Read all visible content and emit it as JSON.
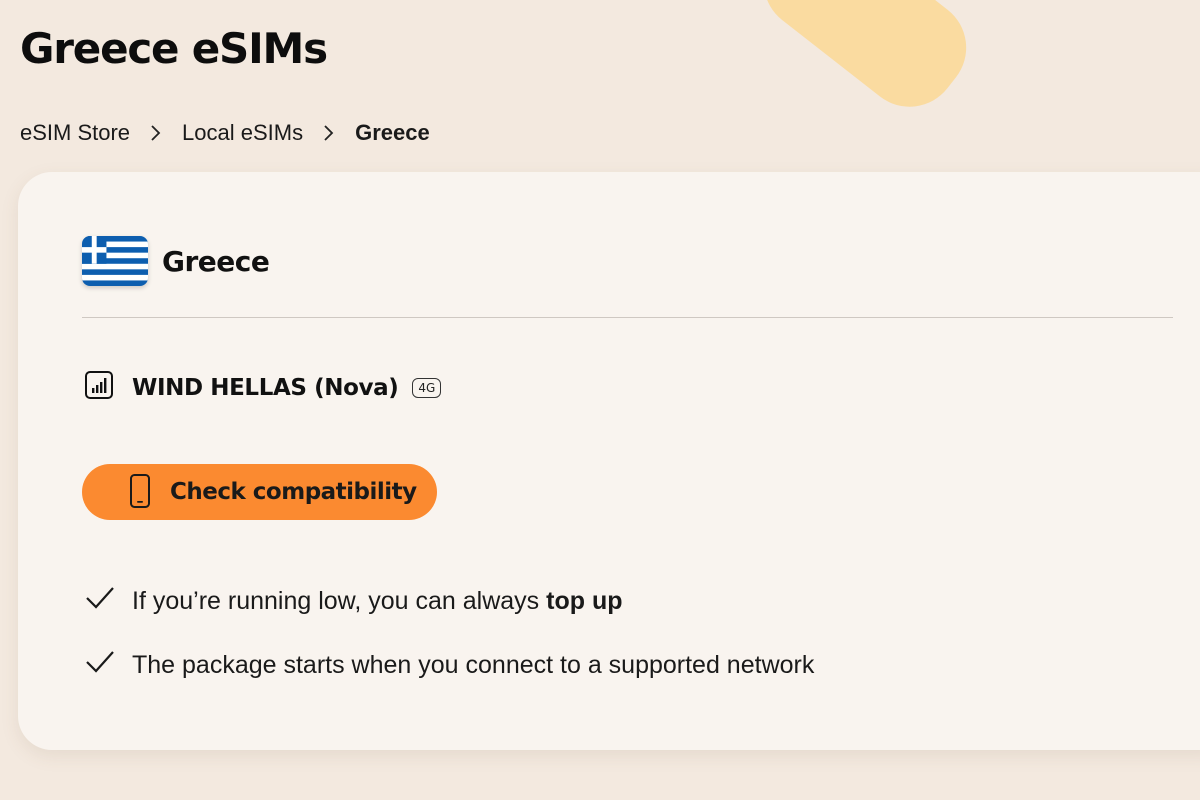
{
  "page": {
    "title": "Greece eSIMs"
  },
  "breadcrumb": {
    "items": [
      "eSIM Store",
      "Local eSIMs",
      "Greece"
    ]
  },
  "card": {
    "country": {
      "name": "Greece",
      "flag_icon": "greece-flag-icon"
    },
    "network": {
      "icon": "signal-bars-icon",
      "operator": "WIND HELLAS (Nova)",
      "technology": "4G"
    },
    "compatibility_button": {
      "icon": "smartphone-icon",
      "label": "Check compatibility"
    },
    "features": [
      {
        "icon": "checkmark-icon",
        "text_before": "If you’re running low, you can always ",
        "text_bold": "top up"
      },
      {
        "icon": "checkmark-icon",
        "text_before": "The package starts when you connect to a supported network",
        "text_bold": ""
      }
    ]
  },
  "colors": {
    "page_background": "#f3e9df",
    "card_background": "#f9f4ef",
    "accent_orange": "#fb8a30",
    "decor_yellow": "#f9d89c",
    "flag_blue": "#0d5eaf"
  }
}
